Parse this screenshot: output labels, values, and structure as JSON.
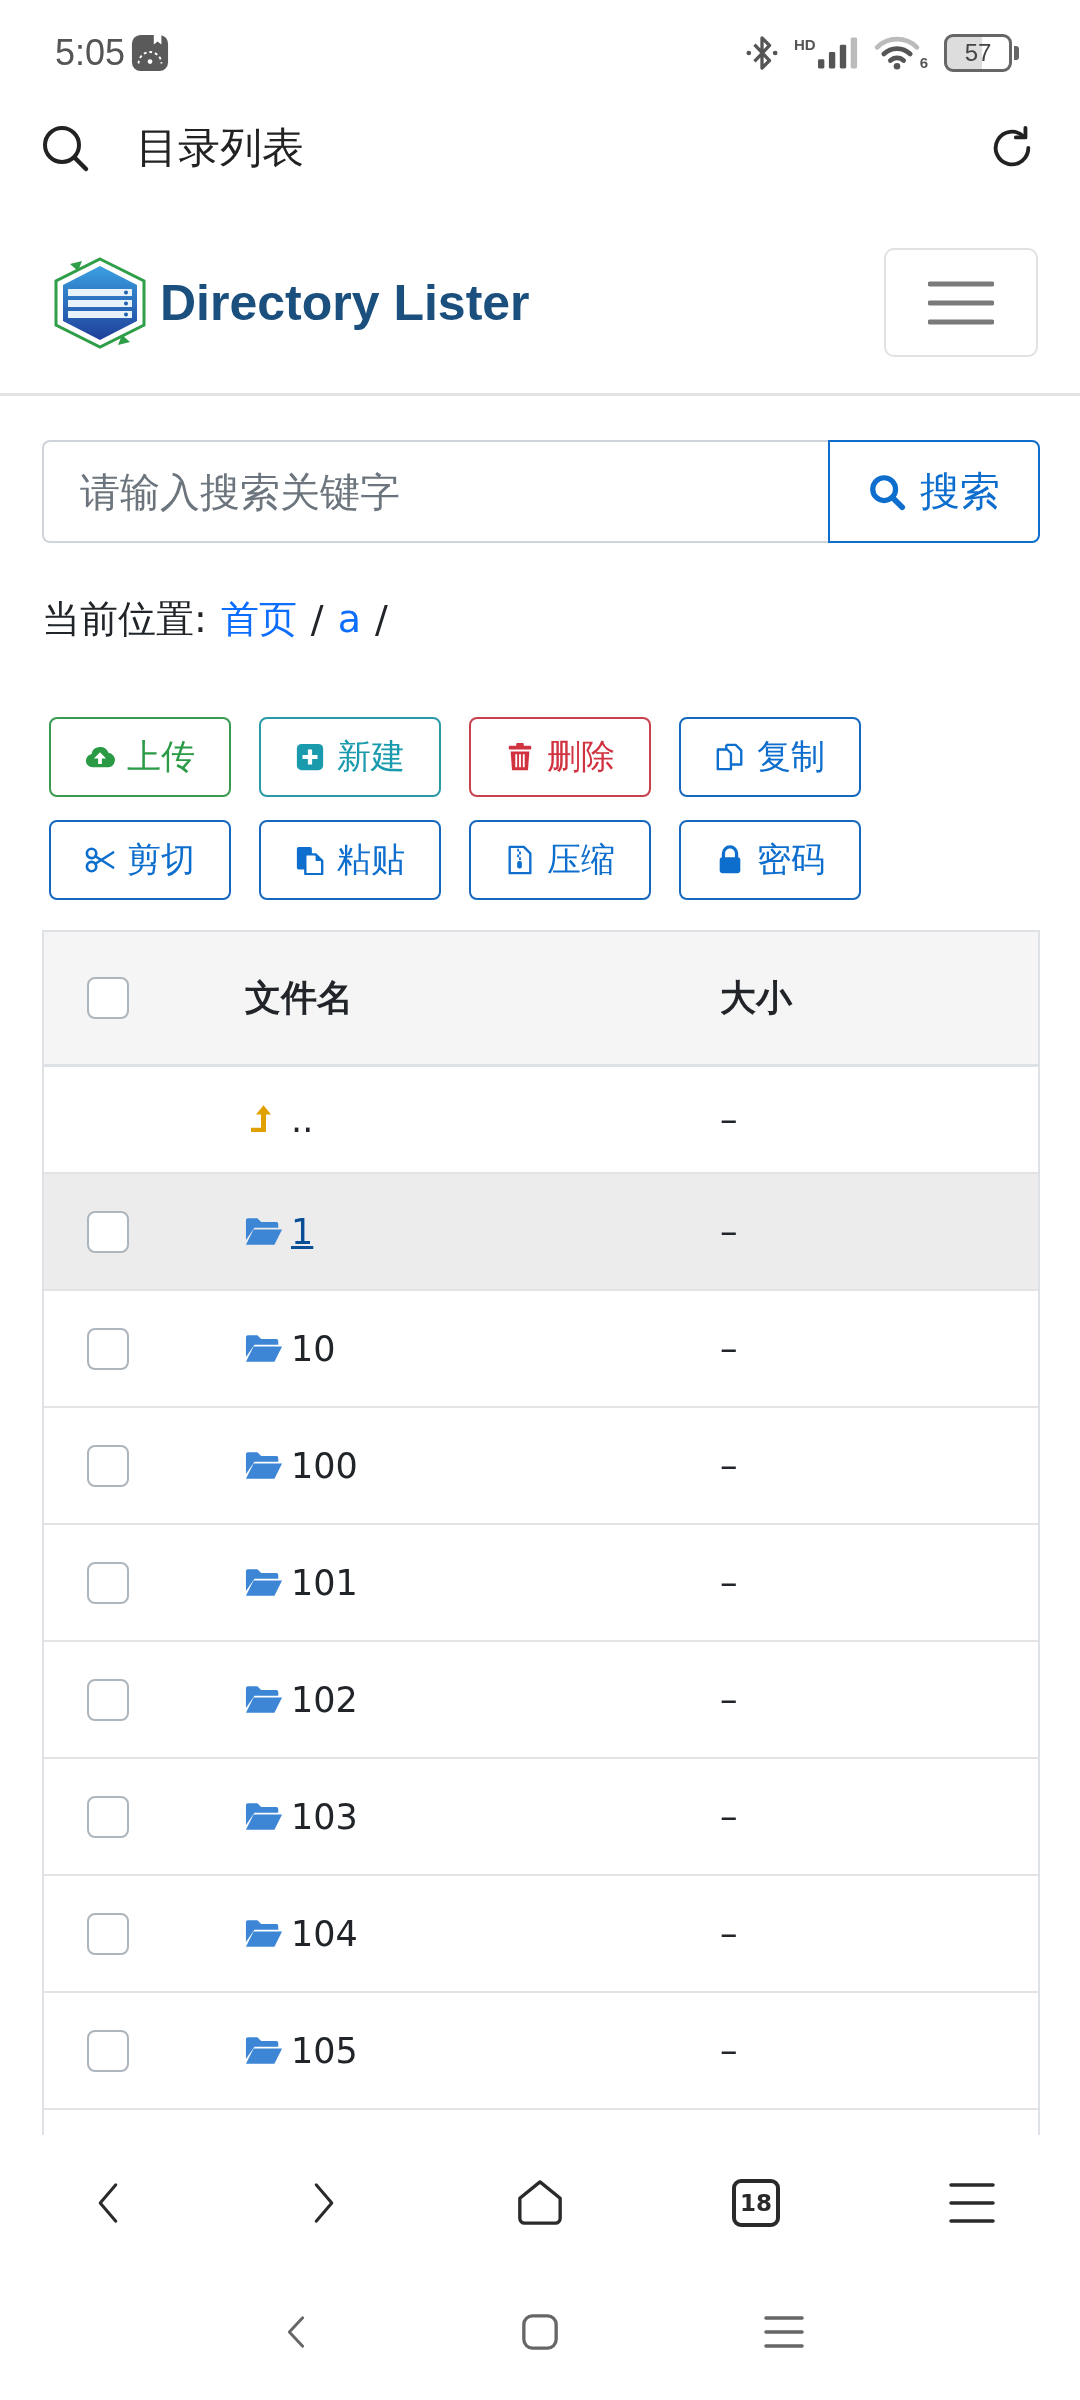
{
  "status_bar": {
    "time": "5:05",
    "network_type": "HD",
    "wifi_standard": "6",
    "battery": "57"
  },
  "app_bar": {
    "title": "目录列表"
  },
  "site_header": {
    "brand": "Directory Lister"
  },
  "search": {
    "placeholder": "请输入搜索关键字",
    "button": "搜索"
  },
  "breadcrumb": {
    "label": "当前位置:",
    "items": [
      {
        "kind": "link",
        "text": "首页"
      },
      {
        "kind": "separator",
        "text": "/"
      },
      {
        "kind": "link",
        "text": "a"
      },
      {
        "kind": "separator",
        "text": "/"
      }
    ]
  },
  "actions": [
    {
      "kind": "upload",
      "label": "上传"
    },
    {
      "kind": "new",
      "label": "新建"
    },
    {
      "kind": "delete",
      "label": "删除"
    },
    {
      "kind": "copy",
      "label": "复制"
    },
    {
      "kind": "cut",
      "label": "剪切"
    },
    {
      "kind": "paste",
      "label": "粘贴"
    },
    {
      "kind": "compress",
      "label": "压缩"
    },
    {
      "kind": "password",
      "label": "密码"
    }
  ],
  "table": {
    "select_all": {
      "checked": false
    },
    "columns": [
      "文件名",
      "大小"
    ],
    "rows": [
      {
        "kind": "parent",
        "name": "..",
        "size": "–"
      },
      {
        "kind": "folder",
        "name": "1",
        "size": "–",
        "checked": false,
        "hovered": true
      },
      {
        "kind": "folder",
        "name": "10",
        "size": "–",
        "checked": false,
        "hovered": false
      },
      {
        "kind": "folder",
        "name": "100",
        "size": "–",
        "checked": false,
        "hovered": false
      },
      {
        "kind": "folder",
        "name": "101",
        "size": "–",
        "checked": false,
        "hovered": false
      },
      {
        "kind": "folder",
        "name": "102",
        "size": "–",
        "checked": false,
        "hovered": false
      },
      {
        "kind": "folder",
        "name": "103",
        "size": "–",
        "checked": false,
        "hovered": false
      },
      {
        "kind": "folder",
        "name": "104",
        "size": "–",
        "checked": false,
        "hovered": false
      },
      {
        "kind": "folder",
        "name": "105",
        "size": "–",
        "checked": false,
        "hovered": false
      }
    ]
  },
  "browser_toolbar": {
    "tab_count": "18"
  }
}
